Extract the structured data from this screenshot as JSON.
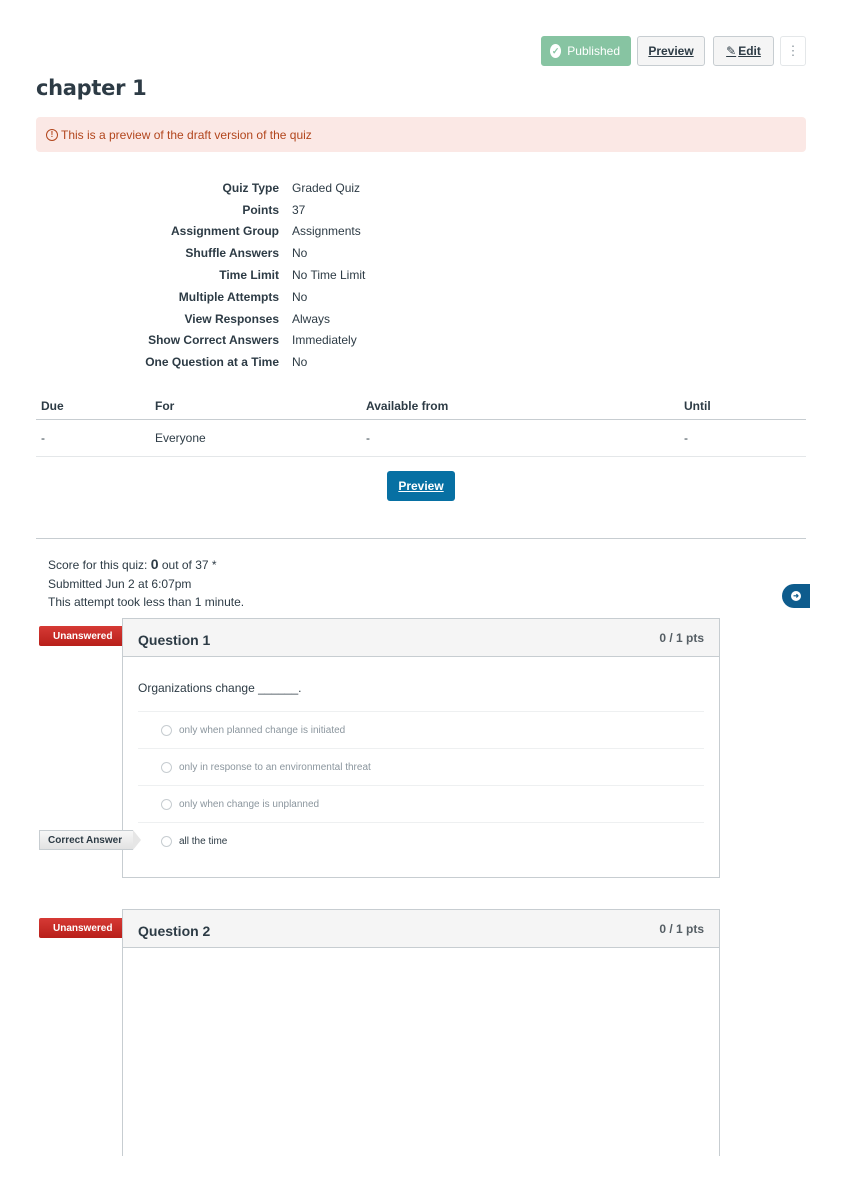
{
  "toolbar": {
    "published_label": "Published",
    "preview_label": "Preview",
    "edit_label": "Edit",
    "more_label": "⋮"
  },
  "page": {
    "title": "chapter 1",
    "alert": "This is a preview of the draft version of the quiz"
  },
  "details": [
    {
      "label": "Quiz Type",
      "value": "Graded Quiz"
    },
    {
      "label": "Points",
      "value": "37"
    },
    {
      "label": "Assignment Group",
      "value": "Assignments"
    },
    {
      "label": "Shuffle Answers",
      "value": "No"
    },
    {
      "label": "Time Limit",
      "value": "No Time Limit"
    },
    {
      "label": "Multiple Attempts",
      "value": "No"
    },
    {
      "label": "View Responses",
      "value": "Always"
    },
    {
      "label": "Show Correct Answers",
      "value": "Immediately"
    },
    {
      "label": "One Question at a Time",
      "value": "No"
    }
  ],
  "due_table": {
    "headers": [
      "Due",
      "For",
      "Available from",
      "Until"
    ],
    "rows": [
      [
        "-",
        "Everyone",
        "-",
        "-"
      ]
    ]
  },
  "preview_button": "Preview",
  "score": {
    "prefix": "Score for this quiz: ",
    "value": "0",
    "suffix": " out of 37 *",
    "submitted": "Submitted Jun 2 at 6:07pm",
    "duration": "This attempt took less than 1 minute."
  },
  "questions": [
    {
      "flag": "Unanswered",
      "name": "Question 1",
      "points": "0 / 1 pts",
      "text": "Organizations change ______.",
      "answers": [
        {
          "text": "only when planned change is initiated",
          "correct": false
        },
        {
          "text": "only in response to an environmental threat",
          "correct": false
        },
        {
          "text": "only when change is unplanned",
          "correct": false
        },
        {
          "text": "all the time",
          "correct": true
        }
      ],
      "correct_flag": "Correct Answer"
    },
    {
      "flag": "Unanswered",
      "name": "Question 2",
      "points": "0 / 1 pts"
    }
  ]
}
